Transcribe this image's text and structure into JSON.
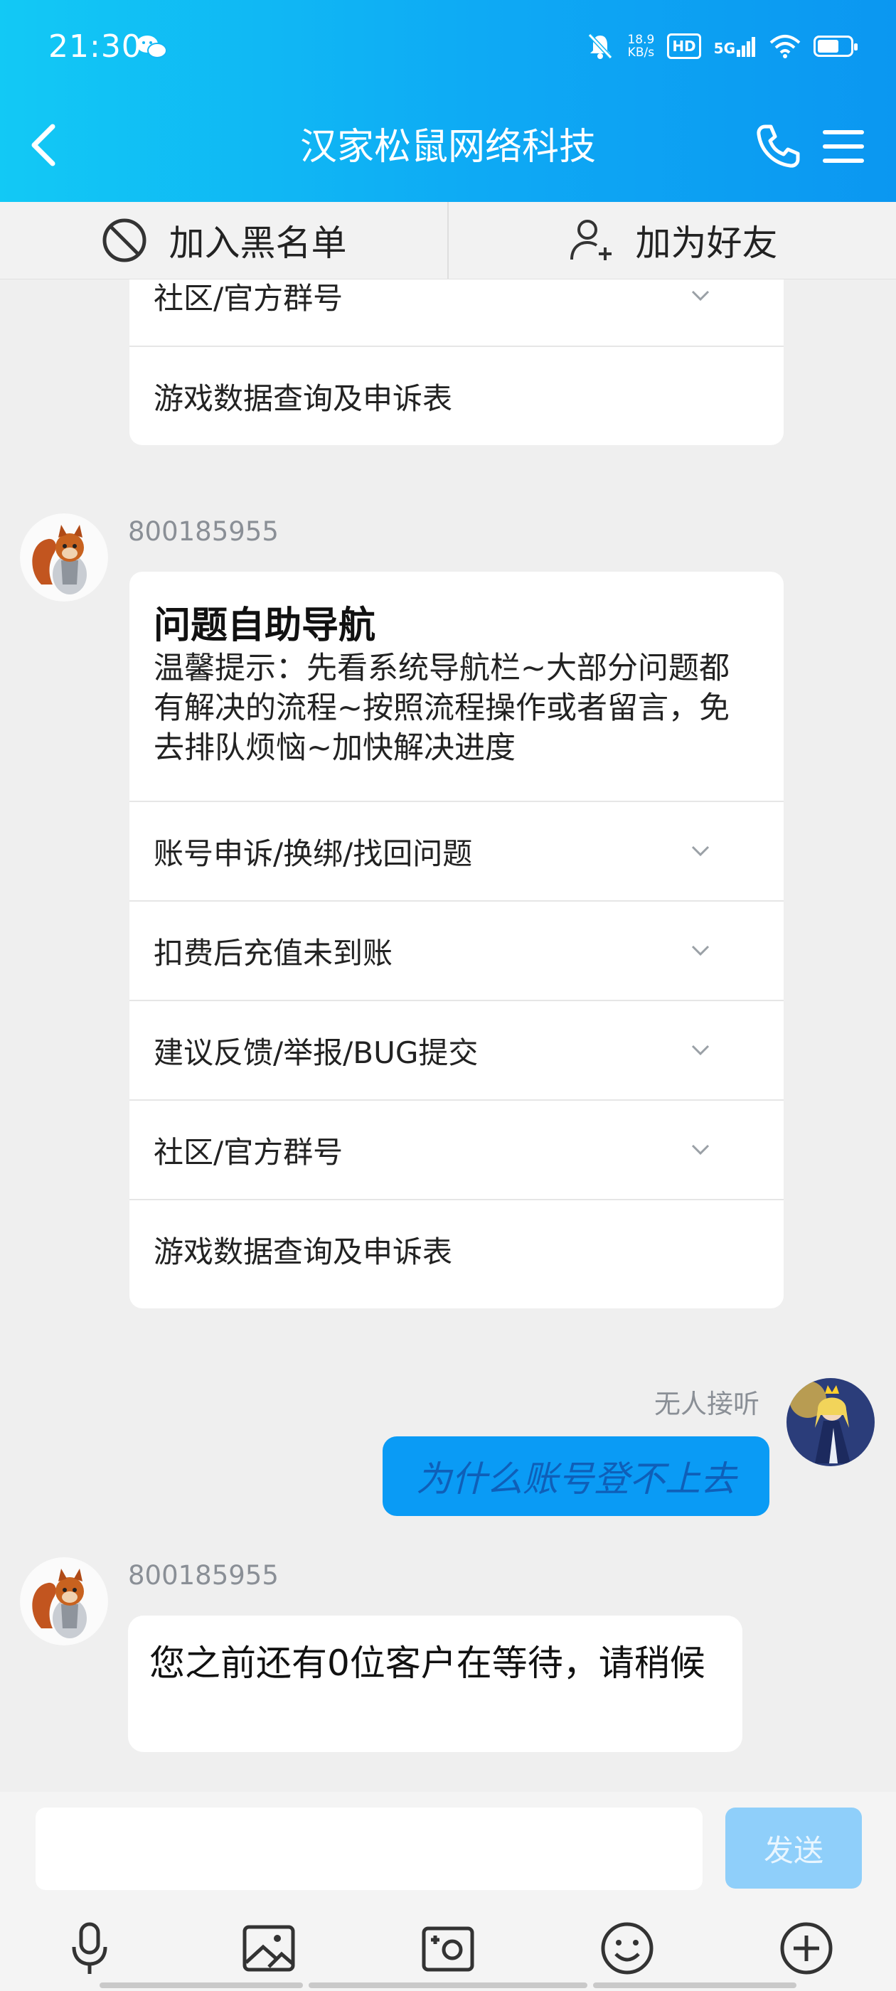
{
  "status_bar": {
    "time": "21:30",
    "net_speed_value": "18.9",
    "net_speed_unit": "KB/s",
    "hd": "HD",
    "network": "5G",
    "battery_level": 0.65
  },
  "header": {
    "title": "汉家松鼠网络科技"
  },
  "actions": {
    "blacklist": "加入黑名单",
    "add_friend": "加为好友"
  },
  "chat": {
    "top_card_items": [
      "社区/官方群号",
      "游戏数据查询及申诉表"
    ],
    "bot_message_1": {
      "sender": "800185955",
      "title": "问题自助导航",
      "text": "温馨提示：先看系统导航栏~大部分问题都有解决的流程~按照流程操作或者留言，免去排队烦恼~加快解决进度",
      "items": [
        "账号申诉/换绑/找回问题",
        "扣费后充值未到账",
        "建议反馈/举报/BUG提交",
        "社区/官方群号",
        "游戏数据查询及申诉表"
      ]
    },
    "user_message": {
      "status": "无人接听",
      "text": "为什么账号登不上去"
    },
    "bot_message_2": {
      "sender": "800185955",
      "text": "您之前还有0位客户在等待，请稍候"
    }
  },
  "input": {
    "placeholder": "",
    "send_label": "发送"
  },
  "toolbar": [
    "microphone-icon",
    "image-icon",
    "camera-icon",
    "emoji-icon",
    "plus-icon"
  ],
  "colors": {
    "header_start": "#12c9f5",
    "header_end": "#0b97f1",
    "bubble": "#0a9bf5",
    "send_disabled": "#8fcffa"
  }
}
